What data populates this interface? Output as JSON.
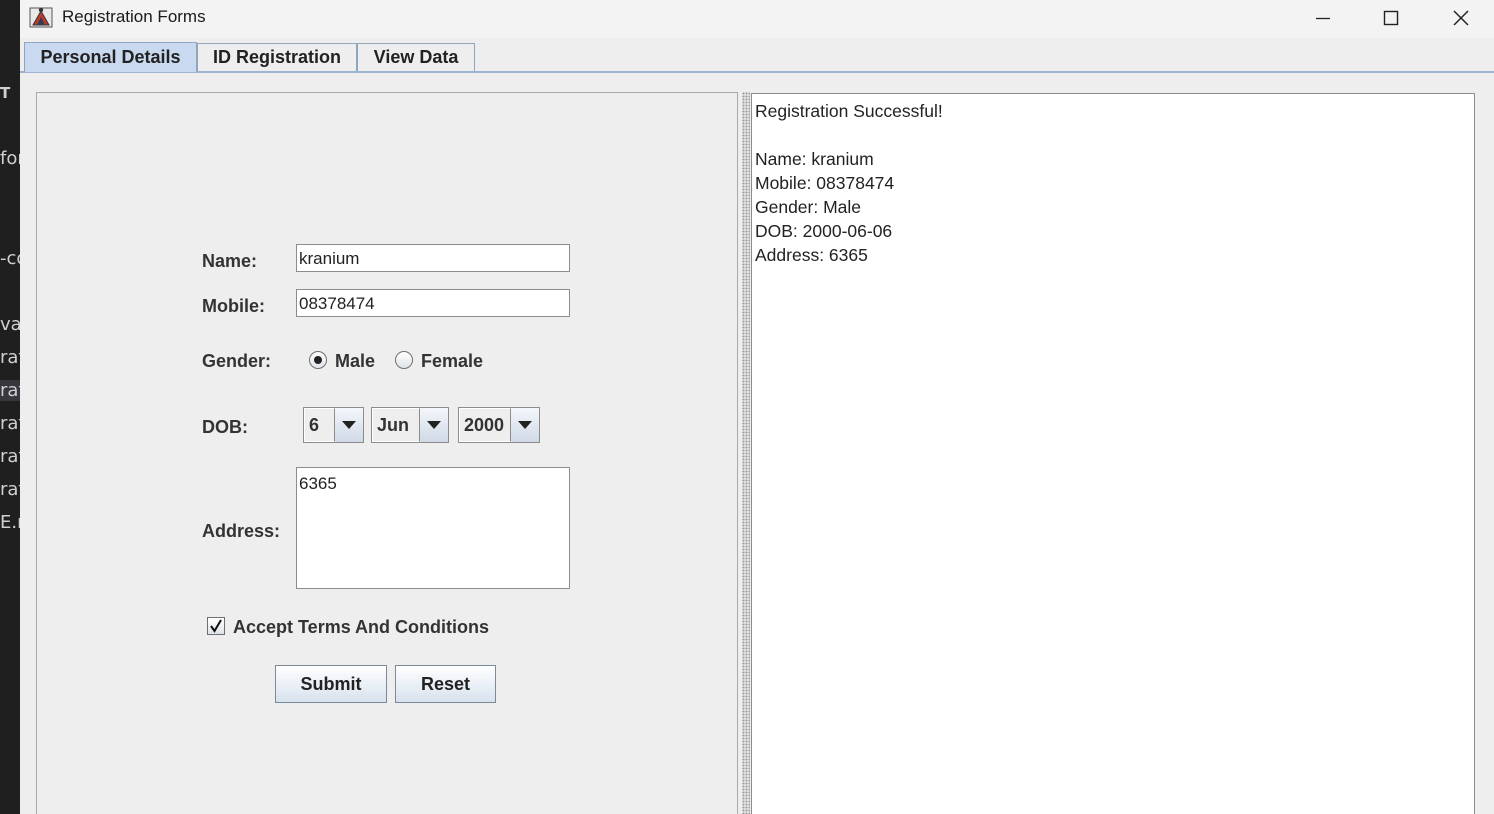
{
  "background_fragments": [
    "T",
    "for",
    "-co",
    "va",
    "rat",
    "rat",
    "rat",
    "rat",
    "rat",
    "E.r"
  ],
  "window": {
    "title": "Registration Forms",
    "controls": {
      "minimize": "minimize",
      "maximize": "maximize",
      "close": "close"
    }
  },
  "tabs": [
    {
      "label": "Personal Details",
      "active": true
    },
    {
      "label": "ID Registration",
      "active": false
    },
    {
      "label": "View Data",
      "active": false
    }
  ],
  "form": {
    "name_label": "Name:",
    "name_value": "kranium",
    "mobile_label": "Mobile:",
    "mobile_value": "08378474",
    "gender_label": "Gender:",
    "gender_male": "Male",
    "gender_female": "Female",
    "gender_selected": "Male",
    "dob_label": "DOB:",
    "dob_day": "6",
    "dob_month": "Jun",
    "dob_year": "2000",
    "address_label": "Address:",
    "address_value": "6365",
    "terms_label": "Accept Terms And Conditions",
    "terms_checked": true,
    "submit_label": "Submit",
    "reset_label": "Reset"
  },
  "output": {
    "lines": [
      "Registration Successful!",
      "",
      "Name: kranium",
      "Mobile: 08378474",
      "Gender: Male",
      "DOB: 2000-06-06",
      "Address: 6365"
    ]
  },
  "colors": {
    "active_tab": "#c9daf0",
    "tab_border": "#8fa6bf",
    "panel_bg": "#eeeeee",
    "button_gradient_bottom": "#d7e2ee"
  },
  "icons": {
    "app": "java-app-icon",
    "combo": "triangle-down-icon",
    "check": "check-mark-icon"
  }
}
